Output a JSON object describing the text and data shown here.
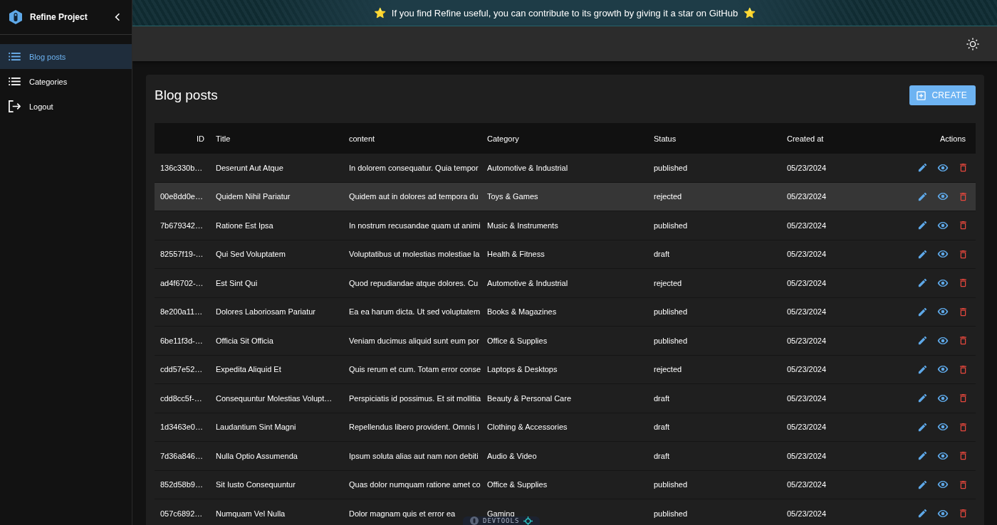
{
  "sidebar": {
    "title": "Refine Project",
    "items": [
      {
        "label": "Blog posts",
        "kind": "list",
        "selected": true
      },
      {
        "label": "Categories",
        "kind": "list",
        "selected": false
      },
      {
        "label": "Logout",
        "kind": "logout",
        "selected": false
      }
    ]
  },
  "banner": {
    "star_left": "⭐",
    "text": "If you find Refine useful, you can contribute to its growth by giving it a star on GitHub",
    "star_right": "⭐"
  },
  "page": {
    "title": "Blog posts",
    "create_button": "CREATE"
  },
  "table": {
    "columns": [
      "ID",
      "Title",
      "content",
      "Category",
      "Status",
      "Created at",
      "Actions"
    ],
    "rows": [
      {
        "id": "136c330b…",
        "title": "Deserunt Aut Atque",
        "content": "In dolorem consequatur. Quia tempor",
        "category": "Automotive & Industrial",
        "status": "published",
        "created_at": "05/23/2024",
        "hovered": false
      },
      {
        "id": "00e8dd0e…",
        "title": "Quidem Nihil Pariatur",
        "content": "Quidem aut in dolores ad tempora du",
        "category": "Toys & Games",
        "status": "rejected",
        "created_at": "05/23/2024",
        "hovered": true
      },
      {
        "id": "7b679342…",
        "title": "Ratione Est Ipsa",
        "content": "In nostrum recusandae quam ut animi",
        "category": "Music & Instruments",
        "status": "published",
        "created_at": "05/23/2024",
        "hovered": false
      },
      {
        "id": "82557f19-…",
        "title": "Qui Sed Voluptatem",
        "content": "Voluptatibus ut molestias molestiae la",
        "category": "Health & Fitness",
        "status": "draft",
        "created_at": "05/23/2024",
        "hovered": false
      },
      {
        "id": "ad4f6702-…",
        "title": "Est Sint Qui",
        "content": "Quod repudiandae atque dolores. Cu",
        "category": "Automotive & Industrial",
        "status": "rejected",
        "created_at": "05/23/2024",
        "hovered": false
      },
      {
        "id": "8e200a11…",
        "title": "Dolores Laboriosam Pariatur",
        "content": "Ea ea harum dicta. Ut sed voluptatem",
        "category": "Books & Magazines",
        "status": "published",
        "created_at": "05/23/2024",
        "hovered": false
      },
      {
        "id": "6be11f3d-…",
        "title": "Officia Sit Officia",
        "content": "Veniam ducimus aliquid sunt eum por",
        "category": "Office & Supplies",
        "status": "published",
        "created_at": "05/23/2024",
        "hovered": false
      },
      {
        "id": "cdd57e52…",
        "title": "Expedita Aliquid Et",
        "content": "Quis rerum et cum. Totam error conse",
        "category": "Laptops & Desktops",
        "status": "rejected",
        "created_at": "05/23/2024",
        "hovered": false
      },
      {
        "id": "cdd8cc5f-…",
        "title": "Consequuntur Molestias Volupt…",
        "content": "Perspiciatis id possimus. Et sit mollitia",
        "category": "Beauty & Personal Care",
        "status": "draft",
        "created_at": "05/23/2024",
        "hovered": false
      },
      {
        "id": "1d3463e0…",
        "title": "Laudantium Sint Magni",
        "content": "Repellendus libero provident. Omnis l",
        "category": "Clothing & Accessories",
        "status": "draft",
        "created_at": "05/23/2024",
        "hovered": false
      },
      {
        "id": "7d36a846…",
        "title": "Nulla Optio Assumenda",
        "content": "Ipsum soluta alias aut nam non debiti",
        "category": "Audio & Video",
        "status": "draft",
        "created_at": "05/23/2024",
        "hovered": false
      },
      {
        "id": "852d58b9…",
        "title": "Sit Iusto Consequuntur",
        "content": "Quas dolor numquam ratione amet co",
        "category": "Office & Supplies",
        "status": "published",
        "created_at": "05/23/2024",
        "hovered": false
      },
      {
        "id": "057c6892…",
        "title": "Numquam Vel Nulla",
        "content": "Dolor magnam quis et error ea",
        "category": "Gaming",
        "status": "published",
        "created_at": "05/23/2024",
        "hovered": false
      }
    ]
  },
  "devtools": {
    "label": "DEVTOOLS"
  }
}
